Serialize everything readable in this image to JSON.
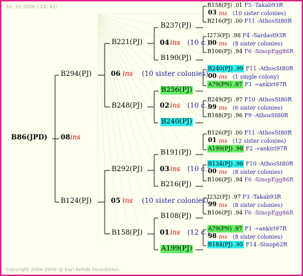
{
  "stamp": "31- 10-2008 ( 23: 41)",
  "copyright": "Copyright 2004-2008 @ Karl Kehde Foundation.",
  "root": {
    "name": "B86(JPD)",
    "year": "08",
    "ins": "ins"
  },
  "gen1": [
    {
      "name": "B294(PJ)",
      "year": "06",
      "ins": "ins",
      "note": "(10 sister colonies)"
    },
    {
      "name": "B124(PJ)",
      "year": "05",
      "ins": "ins",
      "note": "(10 sister colonies)"
    }
  ],
  "gen2": [
    {
      "name": "B221(PJ)",
      "year": "04",
      "ins": "ins",
      "note": "(10 c.)"
    },
    {
      "name": "B248(PJ)",
      "year": "02",
      "ins": "ins",
      "note": "(10 c.)"
    },
    {
      "name": "B292(PJ)",
      "year": "03",
      "ins": "ins",
      "note": "(10 c.)"
    },
    {
      "name": "B158(PJ)",
      "year": "01",
      "ins": "ins",
      "note": "(12 c.)"
    }
  ],
  "gen3": [
    {
      "name": "B237(PJ)",
      "hl": ""
    },
    {
      "name": "B190(PJ)",
      "hl": ""
    },
    {
      "name": "B256(PJ)",
      "hl": "green"
    },
    {
      "name": "B240(PJ)",
      "hl": "cyan"
    },
    {
      "name": "B191(PJ)",
      "hl": ""
    },
    {
      "name": "B216(PJ)",
      "hl": ""
    },
    {
      "name": "B108(PJ)",
      "hl": ""
    },
    {
      "name": "A199(PJ)",
      "hl": "green"
    }
  ],
  "gen4": [
    {
      "top": {
        "name": "B158(PJ)",
        "val": ".01",
        "hl": "",
        "loc": "F5 -Takab93R",
        "lc": "blue"
      },
      "year": "03",
      "ins": "ins",
      "note": "(10 sister colonies)",
      "bot": {
        "name": "B216(PJ)",
        "val": ".00",
        "hl": "",
        "loc": "F11 -AthosSt80R",
        "lc": "blue"
      }
    },
    {
      "top": {
        "name": "I273(PJ)",
        "val": ".98",
        "hl": "",
        "loc": "F4 -Sardast93R",
        "lc": "blue"
      },
      "year": "00",
      "ins": "ins",
      "note": "(8 sister colonies)",
      "bot": {
        "name": "B106(PJ)",
        "val": ".94",
        "hl": "",
        "loc": "F6 -SinopEgg86R",
        "lc": "purple"
      }
    },
    {
      "top": {
        "name": "B240(PJ)",
        "val": ".99",
        "hl": "cyan",
        "loc": "F11 -AthosSt80R",
        "lc": "blue"
      },
      "year": "00",
      "ins": "ins",
      "note": "(1 single colony)",
      "bot": {
        "name": "A79(PN)",
        "val": ".97",
        "hl": "green",
        "loc": "F1 -«ankiri97R",
        "lc": "blue"
      }
    },
    {
      "top": {
        "name": "B249(PJ)",
        "val": ".97",
        "hl": "",
        "loc": "F10 -AthosSt80R",
        "lc": "blue"
      },
      "year": "99",
      "ins": "ins",
      "note": "(6 sister colonies)",
      "bot": {
        "name": "B188(PJ)",
        "val": ".96",
        "hl": "",
        "loc": "F9 -AthosSt80R",
        "lc": "blue"
      }
    },
    {
      "top": {
        "name": "B126(PJ)",
        "val": ".00",
        "hl": "",
        "loc": "F11 -AthosSt80R",
        "lc": "blue"
      },
      "year": "01",
      "ins": "ins",
      "note": "(12 sister colonies)",
      "bot": {
        "name": "A199(PJ)",
        "val": ".98",
        "hl": "green",
        "loc": "F2 -«ankiri97R",
        "lc": "blue"
      }
    },
    {
      "top": {
        "name": "B134(PJ)",
        "val": ".98",
        "hl": "cyan",
        "loc": "F10 -AthosSt80R",
        "lc": "blue"
      },
      "year": "00",
      "ins": "ins",
      "note": "(8 sister colonies)",
      "bot": {
        "name": "B106(PJ)",
        "val": ".94",
        "hl": "",
        "loc": "F6 -SinopEgg86R",
        "lc": "purple"
      }
    },
    {
      "top": {
        "name": "I232(PJ)",
        "val": ".97",
        "hl": "",
        "loc": "F3 -Takab93R",
        "lc": "blue"
      },
      "year": "99",
      "ins": "ins",
      "note": "(8 sister colonies)",
      "bot": {
        "name": "B106(PJ)",
        "val": ".94",
        "hl": "",
        "loc": "F6 -SinopEgg86R",
        "lc": "purple"
      }
    },
    {
      "top": {
        "name": "A79(PN)",
        "val": ".97",
        "hl": "green",
        "loc": "F1 -«ankiri97R",
        "lc": "blue"
      },
      "year": "98",
      "ins": "ins",
      "note": "(8 sister colonies)",
      "bot": {
        "name": "B184(PJ)",
        "val": ".95",
        "hl": "cyan",
        "loc": "F14 -Sinop62R",
        "lc": "blue"
      }
    }
  ],
  "colors": {
    "border": "#e0208a",
    "background": "#fffff0",
    "ins": "#d00000",
    "note": "#1a1aa0",
    "green": "#66ee66",
    "cyan": "#33eeee"
  }
}
